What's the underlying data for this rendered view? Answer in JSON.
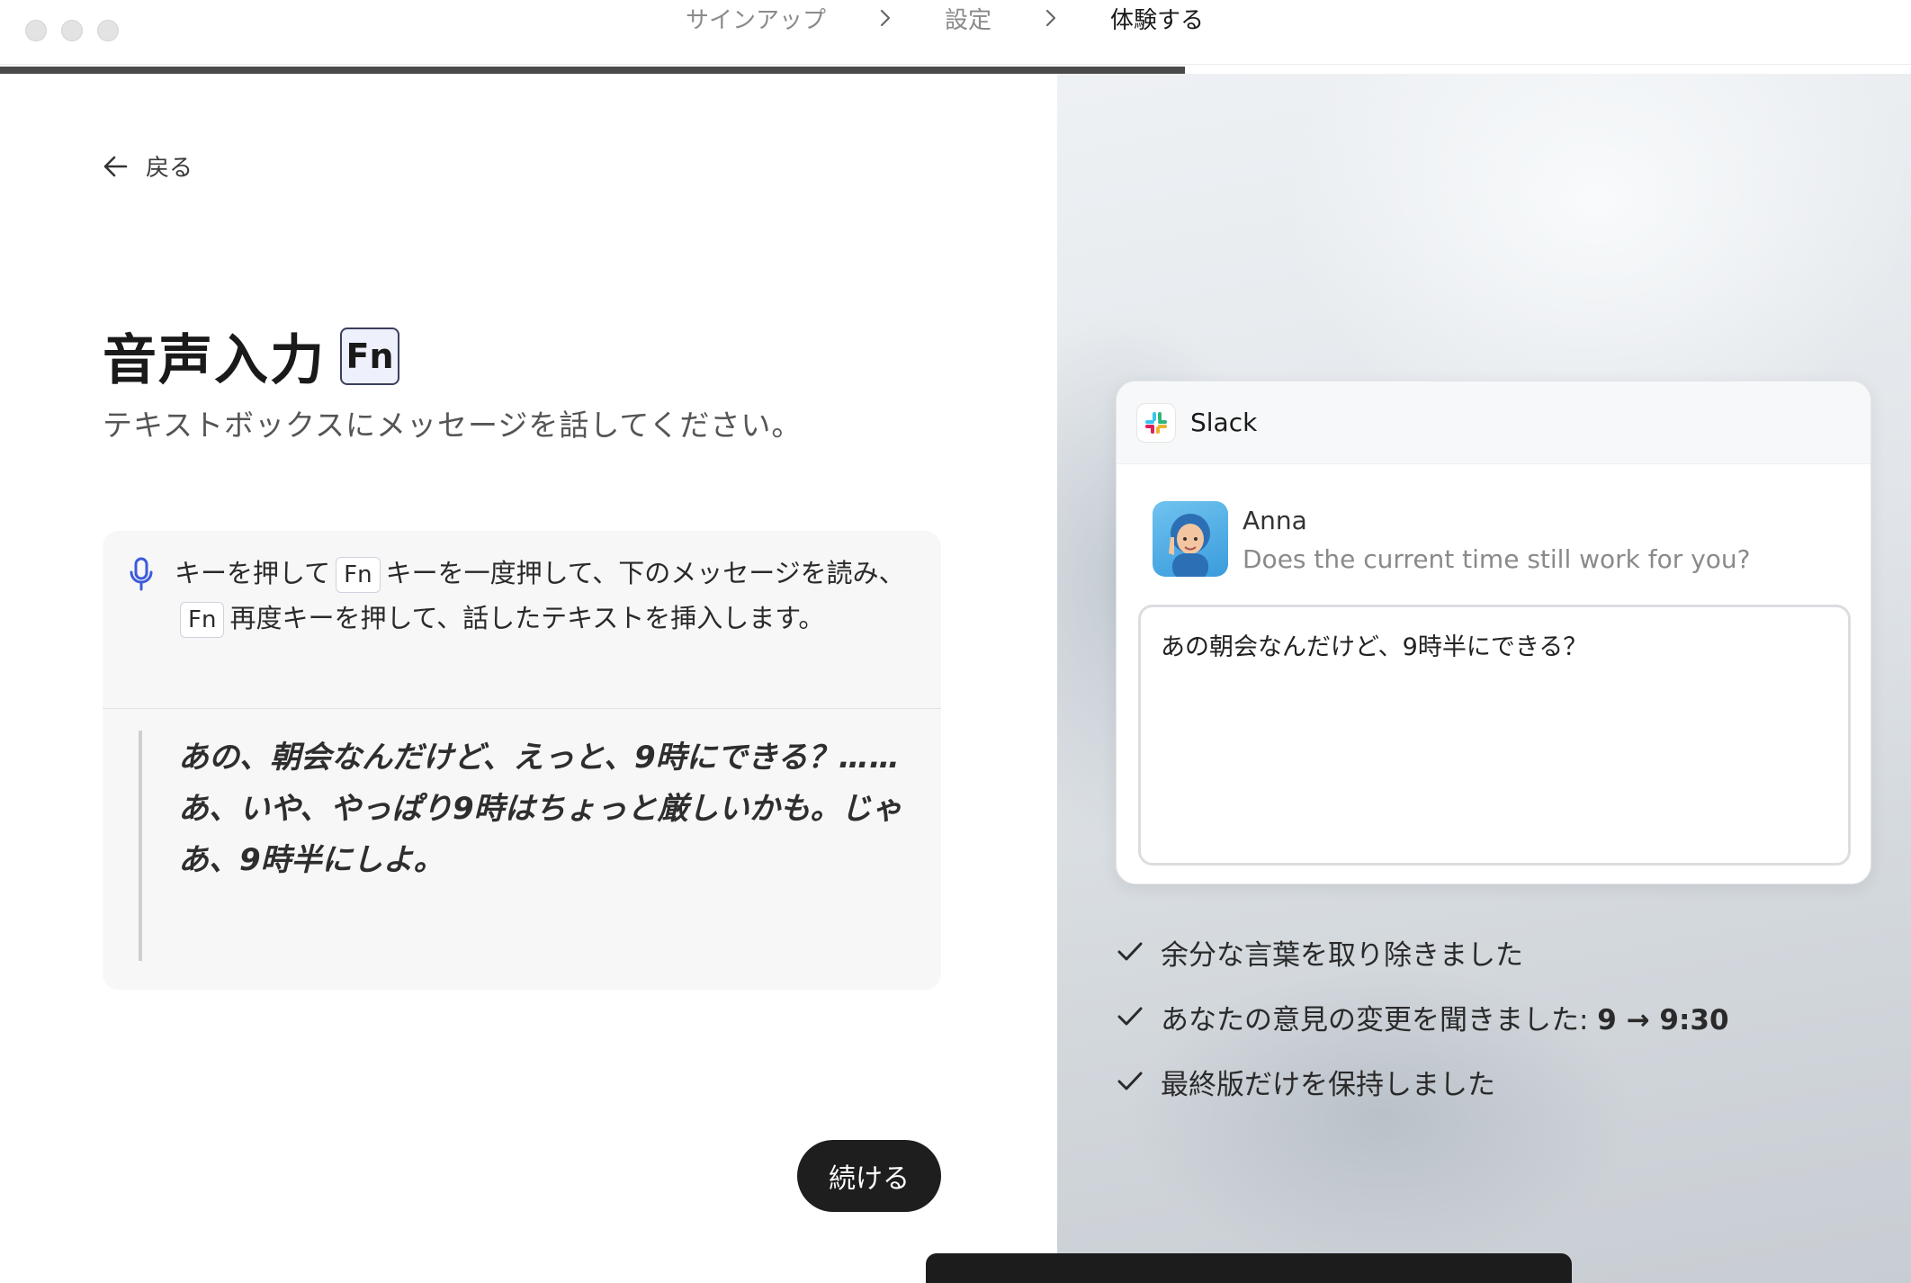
{
  "titlebar": {
    "steps": [
      {
        "label": "サインアップ"
      },
      {
        "label": "設定"
      },
      {
        "label": "体験する"
      }
    ],
    "progress_fraction": 0.62
  },
  "left": {
    "back_label": "戻る",
    "title": "音声入力",
    "fn_key": "Fn",
    "subtitle": "テキストボックスにメッセージを話してください。",
    "instructions": {
      "part1": "キーを押して",
      "key1": "Fn",
      "part2": "キーを一度押して、下のメッセージを読み、",
      "key2": "Fn",
      "part3": "再度キーを押して、話したテキストを挿入します。"
    },
    "quote": "あの、朝会なんだけど、えっと、9時にできる？……あ、いや、やっぱり9時はちょっと厳しいかも。じゃあ、9時半にしよ。",
    "continue_label": "続ける"
  },
  "right": {
    "app_name": "Slack",
    "message": {
      "author": "Anna",
      "text": "Does the current time still work for you?"
    },
    "compose_text": "あの朝会なんだけど、9時半にできる？",
    "checks": [
      {
        "text": "余分な言葉を取り除きました",
        "bold": ""
      },
      {
        "text": "あなたの意見の変更を聞きました: ",
        "bold": "9 → 9:30"
      },
      {
        "text": "最終版だけを保持しました",
        "bold": ""
      }
    ]
  }
}
